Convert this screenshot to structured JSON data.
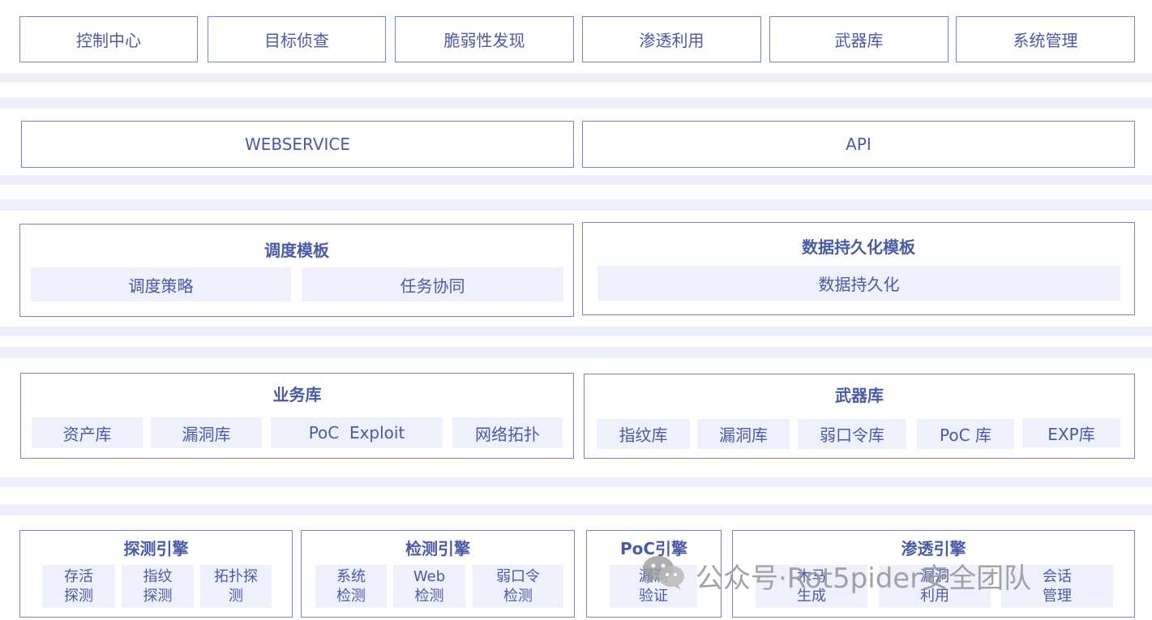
{
  "nav": [
    "控制中心",
    "目标侦查",
    "脆弱性发现",
    "渗透利用",
    "武器库",
    "系统管理"
  ],
  "services": [
    "WEBSERVICE",
    "API"
  ],
  "layer3": {
    "schedule": {
      "title": "调度模板",
      "items": [
        "调度策略",
        "任务协同"
      ]
    },
    "persist": {
      "title": "数据持久化模板",
      "items": [
        "数据持久化"
      ]
    }
  },
  "layer4": {
    "business": {
      "title": "业务库",
      "items": [
        "资产库",
        "漏洞库",
        "PoC  Exploit",
        "网络拓扑"
      ]
    },
    "weapons": {
      "title": "武器库",
      "items": [
        "指纹库",
        "漏洞库",
        "弱口令库",
        "PoC 库",
        "EXP库"
      ]
    }
  },
  "layer5": {
    "probe": {
      "title": "探测引擎",
      "items": [
        "存活\n探测",
        "指纹\n探测",
        "拓扑探\n测"
      ]
    },
    "detect": {
      "title": "检测引擎",
      "items": [
        "系统\n检测",
        "Web\n检测",
        "弱口令\n检测"
      ]
    },
    "poc": {
      "title": "PoC引擎",
      "items": [
        "漏洞\n验证"
      ]
    },
    "pentest": {
      "title": "渗透引擎",
      "items": [
        "木马\n生成",
        "漏洞\n利用",
        "会话\n管理"
      ]
    }
  },
  "watermark": {
    "text": "公众号·Rot5pider安全团队",
    "icon": "wechat-icon"
  },
  "colors": {
    "border": "#7686c6",
    "text": "#4a5aa8",
    "band": "#edf0fa",
    "chip": "#eef0fb"
  }
}
